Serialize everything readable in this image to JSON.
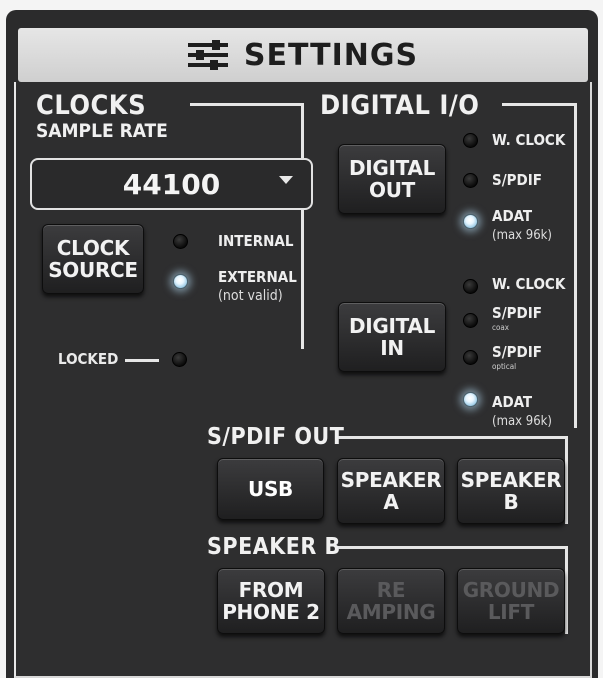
{
  "header": {
    "title": "SETTINGS",
    "icon": "sliders-icon"
  },
  "clocks": {
    "title": "CLOCKS",
    "sample_rate_label": "SAMPLE RATE",
    "sample_rate_value": "44100",
    "clock_source_button": [
      "CLOCK",
      "SOURCE"
    ],
    "options": [
      {
        "label": "INTERNAL",
        "sub": "",
        "active": false
      },
      {
        "label": "EXTERNAL",
        "sub": "(not valid)",
        "active": true
      }
    ],
    "locked_label": "LOCKED"
  },
  "digital_io": {
    "title": "DIGITAL I/O",
    "digital_out_button": [
      "DIGITAL",
      "OUT"
    ],
    "out_options": [
      {
        "label": "W. CLOCK",
        "sub": "",
        "active": false
      },
      {
        "label": "S/PDIF",
        "sub": "",
        "active": false
      },
      {
        "label": "ADAT",
        "sub": "(max 96k)",
        "active": true
      }
    ],
    "digital_in_button": [
      "DIGITAL",
      "IN"
    ],
    "in_options": [
      {
        "label": "W. CLOCK",
        "tiny": "",
        "sub": "",
        "active": false
      },
      {
        "label": "S/PDIF",
        "tiny": "coax",
        "sub": "",
        "active": false
      },
      {
        "label": "S/PDIF",
        "tiny": "optical",
        "sub": "",
        "active": false
      },
      {
        "label": "ADAT",
        "tiny": "",
        "sub": "(max 96k)",
        "active": true
      }
    ]
  },
  "spdif_out": {
    "title": "S/PDIF OUT",
    "buttons": [
      {
        "lines": [
          "USB"
        ],
        "selected": true
      },
      {
        "lines": [
          "SPEAKER",
          "A"
        ],
        "selected": false
      },
      {
        "lines": [
          "SPEAKER",
          "B"
        ],
        "selected": false
      }
    ]
  },
  "speaker_b": {
    "title": "SPEAKER B",
    "buttons": [
      {
        "lines": [
          "FROM",
          "PHONE 2"
        ],
        "enabled": true
      },
      {
        "lines": [
          "RE",
          "AMPING"
        ],
        "enabled": false
      },
      {
        "lines": [
          "GROUND",
          "LIFT"
        ],
        "enabled": false
      }
    ]
  },
  "colors": {
    "panel": "#2b2b2c",
    "text": "#f0f0f0",
    "led_on": "#e8f6ff",
    "disabled_text": "#5a5a5c"
  }
}
